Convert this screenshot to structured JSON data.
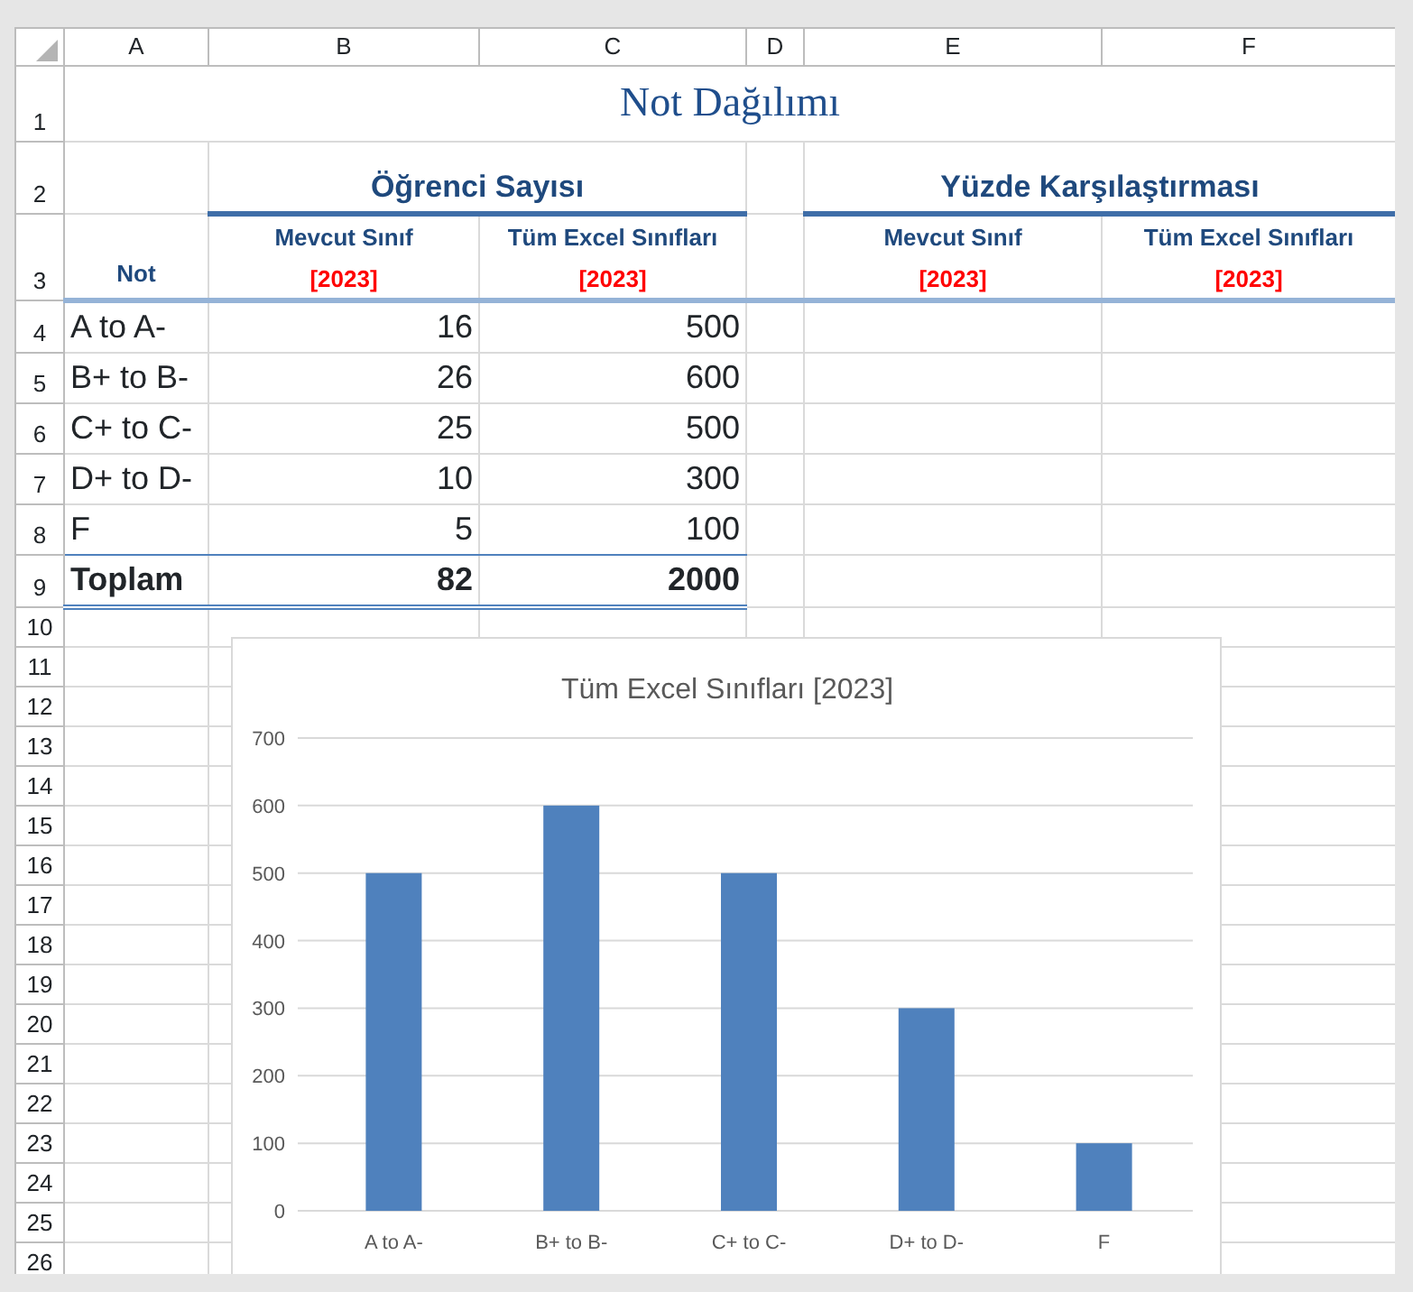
{
  "column_headers": [
    "A",
    "B",
    "C",
    "D",
    "E",
    "F"
  ],
  "row_numbers": [
    "1",
    "2",
    "3",
    "4",
    "5",
    "6",
    "7",
    "8",
    "9",
    "10",
    "11",
    "12",
    "13",
    "14",
    "15",
    "16",
    "17",
    "18",
    "19",
    "20",
    "21",
    "22",
    "23",
    "24",
    "25",
    "26"
  ],
  "title": "Not Dağılımı",
  "group_headers": [
    {
      "label": "Öğrenci Sayısı"
    },
    {
      "label": "Yüzde Karşılaştırması"
    }
  ],
  "grade_header": "Not",
  "sub_headers": [
    {
      "label": "Mevcut Sınıf",
      "year": "[2023]"
    },
    {
      "label": "Tüm Excel Sınıfları",
      "year": "[2023]"
    },
    {
      "label": "Mevcut Sınıf",
      "year": "[2023]"
    },
    {
      "label": "Tüm Excel Sınıfları",
      "year": "[2023]"
    }
  ],
  "rows": [
    {
      "grade": "A to A-",
      "current": "16",
      "all": "500"
    },
    {
      "grade": "B+ to B-",
      "current": "26",
      "all": "600"
    },
    {
      "grade": "C+ to C-",
      "current": "25",
      "all": "500"
    },
    {
      "grade": "D+ to D-",
      "current": "10",
      "all": "300"
    },
    {
      "grade": "F",
      "current": "5",
      "all": "100"
    }
  ],
  "total": {
    "label": "Toplam",
    "current": "82",
    "all": "2000"
  },
  "chart": {
    "chart_data": {
      "type": "bar",
      "grid": true,
      "title": "Tüm Excel Sınıfları [2023]",
      "categories": [
        "A to A-",
        "B+ to B-",
        "C+ to C-",
        "D+ to D-",
        "F"
      ],
      "values": [
        500,
        600,
        500,
        300,
        100
      ],
      "ylim": [
        0,
        700
      ],
      "yticks": [
        0,
        100,
        200,
        300,
        400,
        500,
        600,
        700
      ]
    }
  }
}
